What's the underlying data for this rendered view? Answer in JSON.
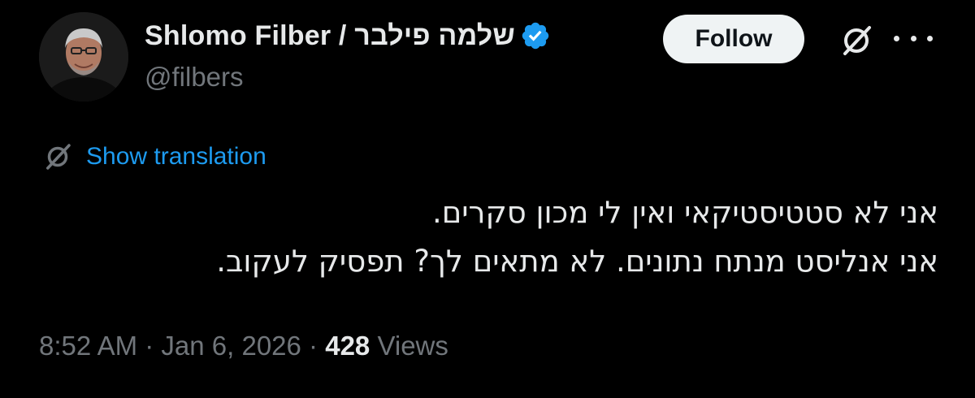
{
  "author": {
    "display_name": "Shlomo Filber / שלמה פילבר",
    "handle": "@filbers",
    "verified_color": "#1d9bf0",
    "avatar_icon": "profile-photo"
  },
  "actions": {
    "follow_label": "Follow",
    "grok_icon": "grok-icon",
    "more_icon": "more-options-icon"
  },
  "translation": {
    "label": "Show translation",
    "icon": "translate-icon"
  },
  "tweet": {
    "lines": [
      "אני לא סטטיסטיקאי ואין לי מכון סקרים.",
      "אני אנליסט מנתח נתונים. לא מתאים לך? תפסיק לעקוב."
    ]
  },
  "meta": {
    "time": "8:52 AM",
    "separator": " · ",
    "date": "Jan 6, 2026",
    "views_count": "428",
    "views_label": " Views"
  },
  "colors": {
    "background": "#000000",
    "text_primary": "#e7e9ea",
    "text_secondary": "#71767b",
    "link": "#1d9bf0",
    "follow_bg": "#eff3f4"
  }
}
